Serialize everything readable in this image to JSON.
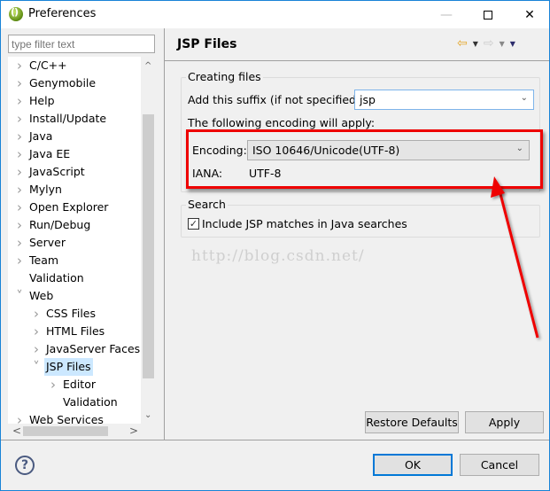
{
  "window": {
    "title": "Preferences",
    "minimize_icon": "minimize-icon",
    "maximize_icon": "maximize-icon",
    "close_icon": "close-icon"
  },
  "sidebar": {
    "filter_placeholder": "type filter text",
    "items": [
      {
        "label": "C/C++",
        "level": 0,
        "chevron": "right"
      },
      {
        "label": "Genymobile",
        "level": 0,
        "chevron": "right"
      },
      {
        "label": "Help",
        "level": 0,
        "chevron": "right"
      },
      {
        "label": "Install/Update",
        "level": 0,
        "chevron": "right"
      },
      {
        "label": "Java",
        "level": 0,
        "chevron": "right"
      },
      {
        "label": "Java EE",
        "level": 0,
        "chevron": "right"
      },
      {
        "label": "JavaScript",
        "level": 0,
        "chevron": "right"
      },
      {
        "label": "Mylyn",
        "level": 0,
        "chevron": "right"
      },
      {
        "label": "Open Explorer",
        "level": 0,
        "chevron": "right"
      },
      {
        "label": "Run/Debug",
        "level": 0,
        "chevron": "right"
      },
      {
        "label": "Server",
        "level": 0,
        "chevron": "right"
      },
      {
        "label": "Team",
        "level": 0,
        "chevron": "right"
      },
      {
        "label": "Validation",
        "level": 0,
        "chevron": "none"
      },
      {
        "label": "Web",
        "level": 0,
        "chevron": "down"
      },
      {
        "label": "CSS Files",
        "level": 1,
        "chevron": "right"
      },
      {
        "label": "HTML Files",
        "level": 1,
        "chevron": "right"
      },
      {
        "label": "JavaServer Faces T",
        "level": 1,
        "chevron": "right"
      },
      {
        "label": "JSP Files",
        "level": 1,
        "chevron": "down",
        "selected": true
      },
      {
        "label": "Editor",
        "level": 2,
        "chevron": "right"
      },
      {
        "label": "Validation",
        "level": 2,
        "chevron": "none"
      },
      {
        "label": "Web Services",
        "level": 0,
        "chevron": "right"
      }
    ]
  },
  "page": {
    "title": "JSP Files",
    "nav": {
      "back_icon": "back-arrow-icon",
      "forward_icon": "forward-arrow-icon",
      "menu_icon": "view-menu-icon"
    },
    "creating_files": {
      "legend": "Creating files",
      "suffix_label": "Add this suffix (if not specified):",
      "suffix_value": "jsp",
      "encoding_note": "The following encoding will apply:",
      "encoding_label": "Encoding:",
      "encoding_value": "ISO 10646/Unicode(UTF-8)",
      "iana_label": "IANA:",
      "iana_value": "UTF-8"
    },
    "search": {
      "legend": "Search",
      "include_label": "Include JSP matches in Java searches",
      "include_checked": true
    },
    "watermark": "http://blog.csdn.net/",
    "restore_defaults_label": "Restore Defaults",
    "apply_label": "Apply"
  },
  "footer": {
    "ok_label": "OK",
    "cancel_label": "Cancel"
  },
  "annotation": {
    "color": "#ee0000"
  }
}
